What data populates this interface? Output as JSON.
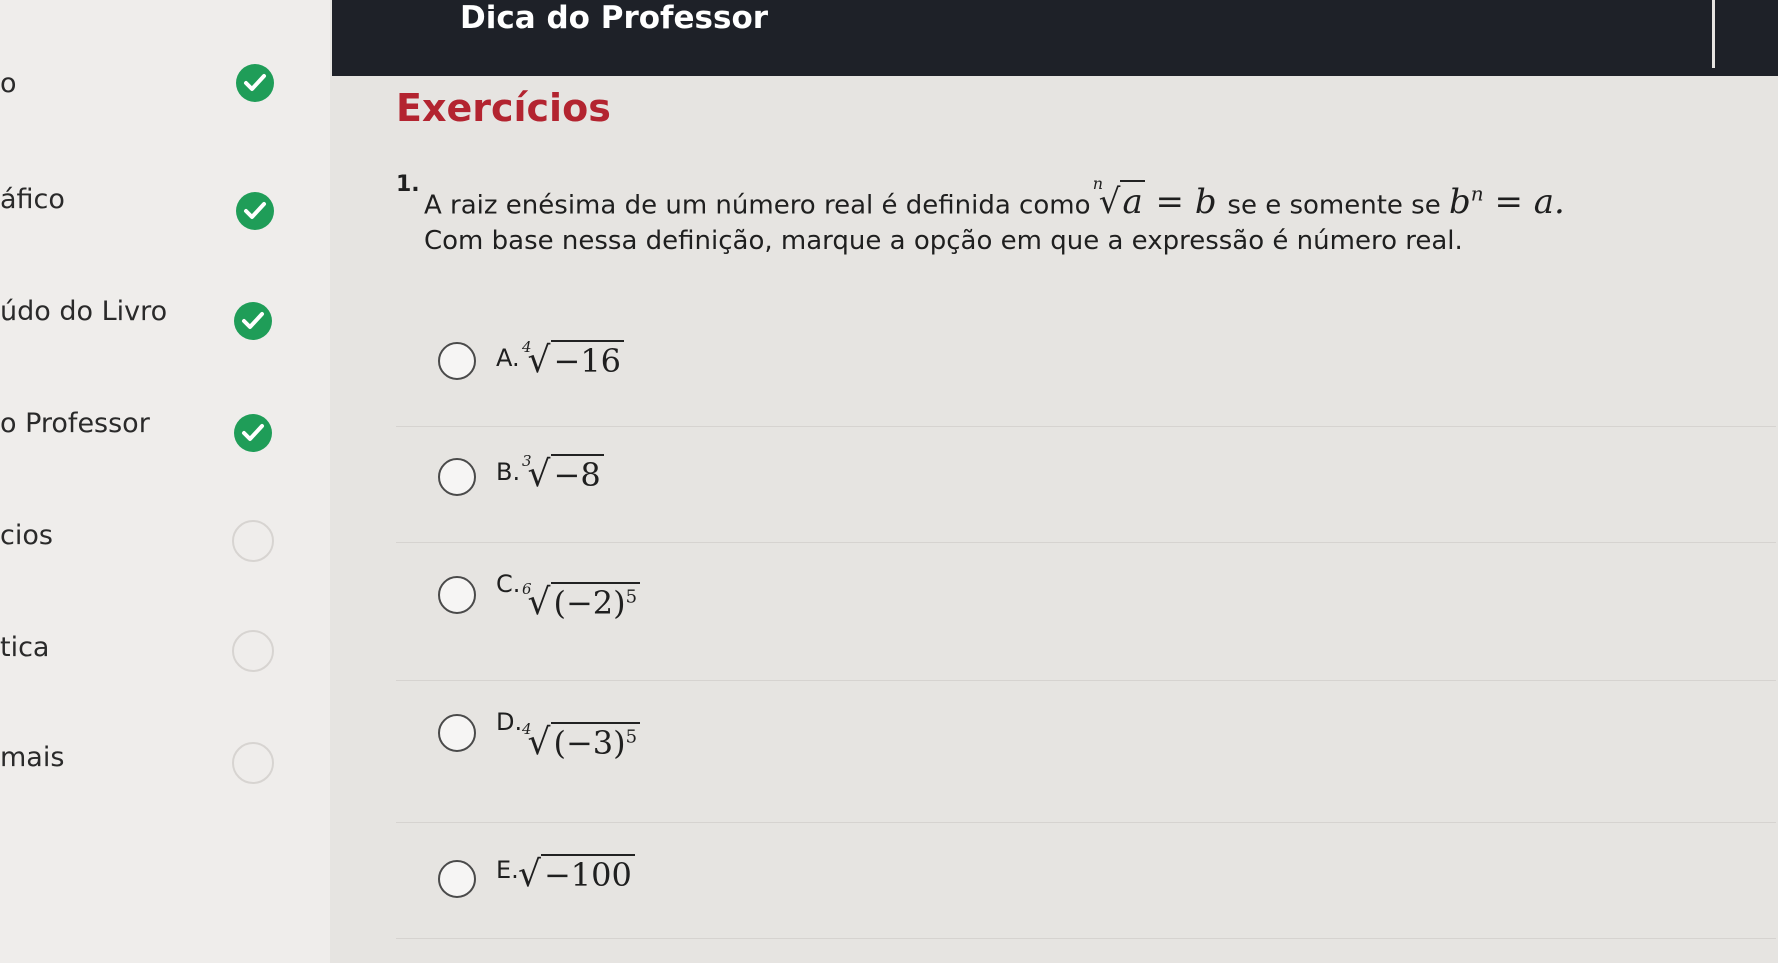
{
  "sidebar": {
    "items": [
      {
        "label": "o",
        "status": "done"
      },
      {
        "label": "áfico",
        "status": "done"
      },
      {
        "label": "údo do Livro",
        "status": "done"
      },
      {
        "label": "o Professor",
        "status": "done"
      },
      {
        "label": "cios",
        "status": "todo"
      },
      {
        "label": "tica",
        "status": "todo"
      },
      {
        "label": "mais",
        "status": "todo"
      }
    ]
  },
  "topbar": {
    "title": "Dica do Professor"
  },
  "main": {
    "section_title": "Exercícios",
    "question": {
      "number": "1.",
      "line1_text": "A raiz enésima de um número real é definida como",
      "line1_formula_index": "n",
      "line1_formula_radicand": "a",
      "line1_formula_rest": " = b",
      "line1_mid": " se e somente se ",
      "line1_formula2": "b",
      "line1_formula2_exp": "n",
      "line1_formula2_rest": " = a.",
      "line2_text": "Com base nessa definição, marque a opção em que a expressão é número real."
    },
    "options": [
      {
        "letter": "A.",
        "index": "4",
        "radicand": "−16",
        "power": ""
      },
      {
        "letter": "B.",
        "index": "3",
        "radicand": "−8",
        "power": ""
      },
      {
        "letter": "C.",
        "index": "6",
        "radicand": "(−2)",
        "power": "5"
      },
      {
        "letter": "D.",
        "index": "4",
        "radicand": "(−3)",
        "power": "5"
      },
      {
        "letter": "E.",
        "index": "",
        "radicand": "−100",
        "power": ""
      }
    ]
  },
  "colors": {
    "accent_red": "#b32430",
    "check_green": "#1f9d58",
    "topbar_bg": "#1e2128"
  }
}
